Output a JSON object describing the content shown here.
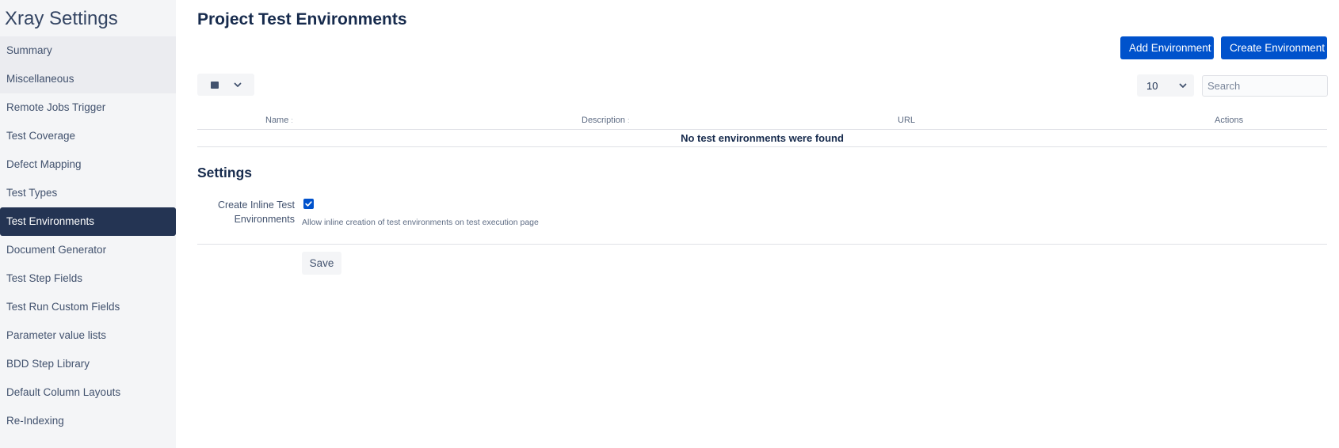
{
  "sidebar": {
    "title": "Xray Settings",
    "items": [
      {
        "label": "Summary"
      },
      {
        "label": "Miscellaneous"
      },
      {
        "label": "Remote Jobs Trigger"
      },
      {
        "label": "Test Coverage"
      },
      {
        "label": "Defect Mapping"
      },
      {
        "label": "Test Types"
      },
      {
        "label": "Test Environments",
        "active": true
      },
      {
        "label": "Document Generator"
      },
      {
        "label": "Test Step Fields"
      },
      {
        "label": "Test Run Custom Fields"
      },
      {
        "label": "Parameter value lists"
      },
      {
        "label": "BDD Step Library"
      },
      {
        "label": "Default Column Layouts"
      },
      {
        "label": "Re-Indexing"
      }
    ]
  },
  "main": {
    "title": "Project Test Environments",
    "add_button": "Add Environment",
    "create_button": "Create Environment",
    "page_size": "10",
    "search_placeholder": "Search",
    "table": {
      "columns": [
        "Name",
        "Description",
        "URL",
        "Actions"
      ],
      "empty_message": "No test environments were found"
    }
  },
  "settings": {
    "heading": "Settings",
    "inline_label": "Create Inline Test Environments",
    "inline_checked": true,
    "inline_help": "Allow inline creation of test environments on test execution page",
    "save_label": "Save"
  },
  "colors": {
    "primary": "#0052cc",
    "active_nav": "#243453",
    "sidebar_bg": "#f4f5f7"
  },
  "icons": [
    "square-icon",
    "chevron-down-icon",
    "checkmark-icon",
    "sort-icon"
  ]
}
